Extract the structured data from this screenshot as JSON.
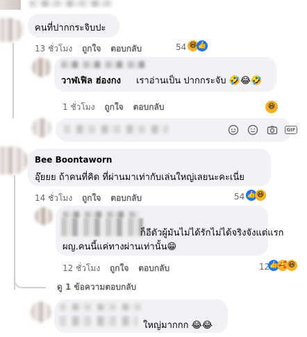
{
  "comments": [
    {
      "text": "คนที่ปากกระจิบปะ",
      "time": "13 ชั่วโมง",
      "like_label": "ถูกใจ",
      "reply_label": "ตอบกลับ",
      "reaction_count": "54",
      "reactions": [
        "haha-icon",
        "like-icon"
      ]
    },
    {
      "author": "วาฬเฟิล ฮ่องกง",
      "text": "เราอ่านเป็น ปากกระจับ 🤣😂🤣",
      "time": "1 ชั่วโมง",
      "like_label": "ถูกใจ",
      "reply_label": "ตอบกลับ",
      "reactions": [
        "haha-icon"
      ]
    },
    {
      "author": "Bee Boontaworn",
      "text": "อุ๊ยยย ถ้าคนที่คิด ที่ผ่านมาเท่ากับเล่นใหญ่เลยนะคะเนี่ย",
      "time": "14 ชั่วโมง",
      "like_label": "ถูกใจ",
      "reply_label": "ตอบกลับ",
      "reaction_count": "54",
      "reactions": [
        "haha-icon",
        "like-icon"
      ]
    },
    {
      "text_line1": "ก็อีตัวผู้มันไม่ได้รักไม่ได้จริงจังแต่แรก",
      "text_line2": "ผญ.คนนี้แค่ทางผ่านเท่านั้น😁",
      "time": "12 ชั่วโมง",
      "like_label": "ถูกใจ",
      "reply_label": "ตอบกลับ",
      "reaction_count": "12",
      "reactions": [
        "like-icon",
        "care-icon",
        "haha-icon"
      ]
    },
    {
      "view_replies": "ดู 1 ข้อความตอบกลับ"
    },
    {
      "text": "ใหญ่มากกก 😂😂"
    }
  ],
  "composer": {
    "icons": [
      "sticker-icon",
      "emoji-icon",
      "camera-icon",
      "gif-icon"
    ],
    "gif_label": "GIF"
  },
  "colors": {
    "bubble": "#f0f2f5",
    "meta": "#65676b",
    "like": "#1877f2",
    "haha": "#f7b125"
  }
}
